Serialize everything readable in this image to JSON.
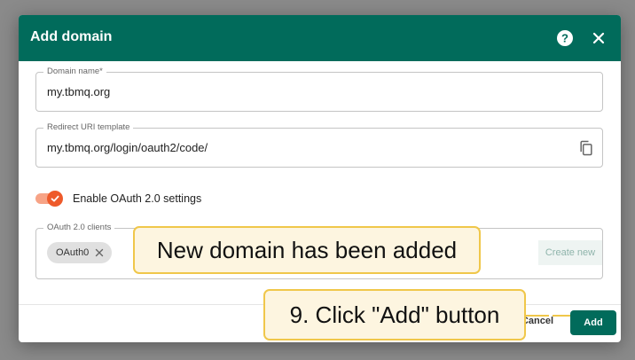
{
  "dialog": {
    "title": "Add domain",
    "help_icon": "help-circle-icon",
    "close_icon": "close-icon"
  },
  "domain_name": {
    "label": "Domain name*",
    "value": "my.tbmq.org"
  },
  "redirect_uri": {
    "label": "Redirect URI template",
    "value": "my.tbmq.org/login/oauth2/code/",
    "copy_icon": "copy-icon"
  },
  "oauth_toggle": {
    "label": "Enable OAuth 2.0 settings",
    "checked": true
  },
  "oauth_clients": {
    "label": "OAuth 2.0 clients",
    "chips": [
      {
        "label": "OAuth0"
      }
    ],
    "create_new_label": "Create new"
  },
  "footer": {
    "cancel_label": "Cancel",
    "add_label": "Add"
  },
  "callouts": {
    "domain_added": "New domain has been added",
    "step_9": "9. Click \"Add\" button"
  },
  "colors": {
    "header": "#016b5b",
    "toggle_on": "#ee5a2a",
    "callout_border": "#f0c74a",
    "callout_bg": "#fdf5e0"
  }
}
